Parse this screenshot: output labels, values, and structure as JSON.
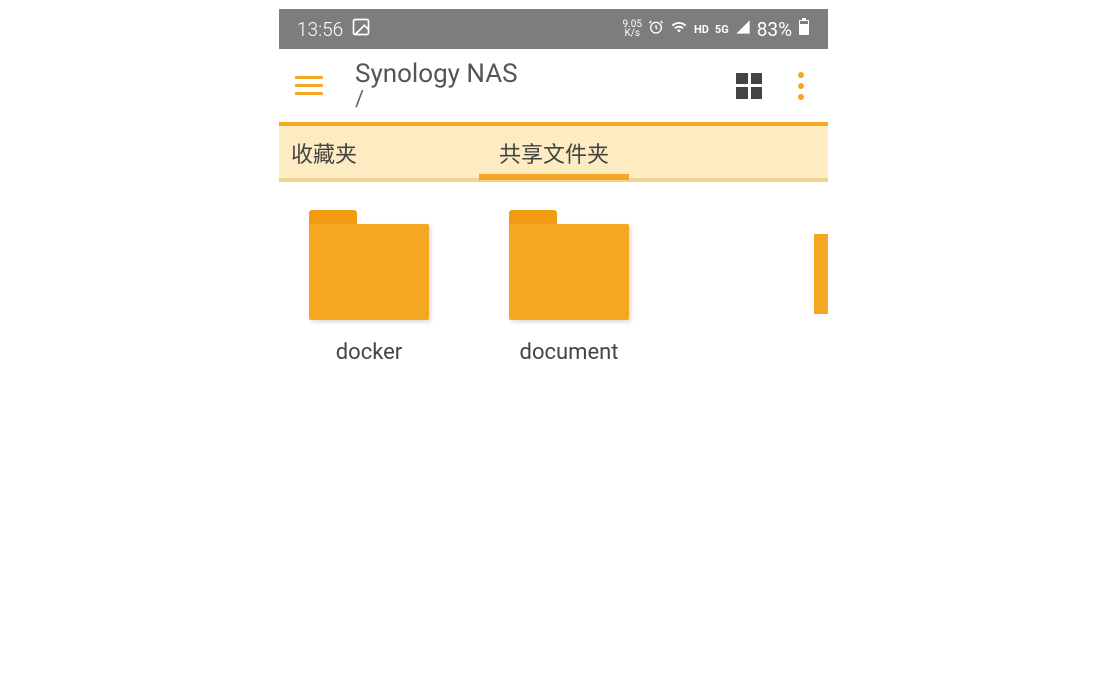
{
  "status": {
    "time": "13:56",
    "net_speed_top": "9.05",
    "net_speed_bottom": "K/s",
    "alarm": "⏰",
    "wifi": "📶",
    "hd": "HD",
    "network": "5G",
    "signal": "📶",
    "battery_pct": "83%",
    "battery_icon": "🔋"
  },
  "header": {
    "title": "Synology NAS",
    "path": "/"
  },
  "tabs": {
    "favorites": "收藏夹",
    "shared": "共享文件夹"
  },
  "folders": [
    {
      "name": "docker"
    },
    {
      "name": "document"
    }
  ],
  "colors": {
    "accent": "#f5a623",
    "tab_bg": "#fdecc2"
  }
}
